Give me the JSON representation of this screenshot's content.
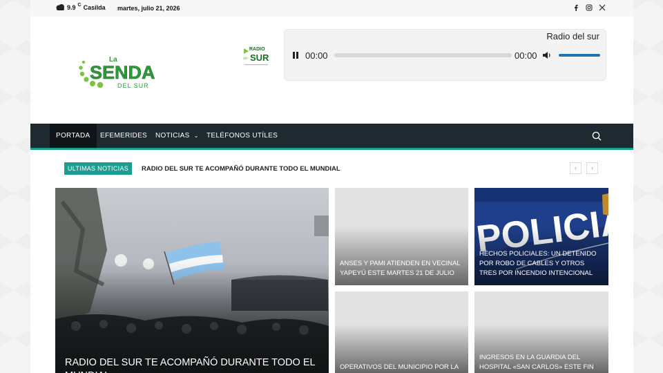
{
  "topbar": {
    "temperature": "9.9",
    "temp_unit": "C",
    "city": "Casilda",
    "date": "martes, julio 21, 2026",
    "social_icons": [
      "facebook-icon",
      "instagram-icon",
      "x-twitter-icon"
    ]
  },
  "logo": {
    "line1": "La",
    "line2": "SENDA",
    "line3": "DEL SUR",
    "color": "#2e9a3a"
  },
  "radio_logo": {
    "top": "RADIO",
    "main": "SUR",
    "small": "del"
  },
  "player": {
    "title": "Radio del sur",
    "current_time": "00:00",
    "duration": "00:00",
    "volume": 1.0
  },
  "nav": {
    "items": [
      {
        "label": "PORTADA",
        "active": true
      },
      {
        "label": "EFEMERIDES"
      },
      {
        "label": "NOTICIAS",
        "has_dropdown": true
      },
      {
        "label": "TELÉFONOS UTÍLES"
      }
    ],
    "bar_color": "#1f2a30",
    "accent": "#1b9e92"
  },
  "ticker": {
    "label": "ULTIMAS NOTICIAS",
    "headline": "RADIO DEL SUR TE ACOMPAÑÓ DURANTE TODO EL MUNDIAL",
    "prev": "‹",
    "next": "›"
  },
  "tiles": [
    {
      "title": "RADIO DEL SUR TE ACOMPAÑÓ DURANTE TODO EL MUNDIAL"
    },
    {
      "title": "ANSES Y PAMI ATIENDEN EN VECINAL YAPEYÚ ESTE MARTES 21 DE JULIO"
    },
    {
      "title": "HECHOS POLICIALES: UN DETENIDO POR ROBO DE CABLES Y OTROS TRES POR INCENDIO INTENCIONAL",
      "image_text": "POLICIA"
    },
    {
      "title": "OPERATIVOS DEL MUNICIPIO POR LA"
    },
    {
      "title": "INGRESOS EN LA GUARDIA DEL HOSPITAL «SAN CARLOS» ESTE FIN DE"
    }
  ]
}
